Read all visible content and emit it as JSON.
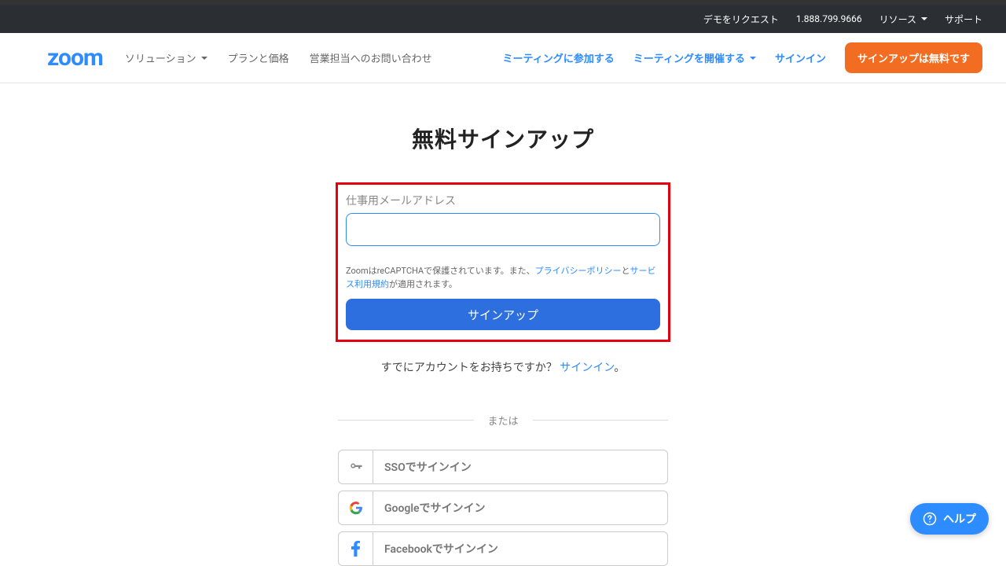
{
  "topbar": {
    "demo": "デモをリクエスト",
    "phone": "1.888.799.9666",
    "resources": "リソース",
    "support": "サポート"
  },
  "logo": "zoom",
  "nav": {
    "solutions": "ソリューション",
    "plans": "プランと価格",
    "contact_sales": "営業担当へのお問い合わせ",
    "join_meeting": "ミーティングに参加する",
    "host_meeting": "ミーティングを開催する",
    "sign_in": "サインイン",
    "signup_free": "サインアップは無料です"
  },
  "page": {
    "title": "無料サインアップ",
    "email_label": "仕事用メールアドレス",
    "legal_prefix": "ZoomはreCAPTCHAで保護されています。また、",
    "privacy": "プライバシーポリシー",
    "legal_and": "と",
    "terms": "サービス利用規約",
    "legal_suffix": "が適用されます。",
    "signup_button": "サインアップ",
    "already_prefix": "すでにアカウントをお持ちですか？",
    "signin_link": "サインイン",
    "already_suffix": "。",
    "divider": "または"
  },
  "social": {
    "sso": "SSOでサインイン",
    "google": "Googleでサインイン",
    "facebook": "Facebookでサインイン"
  },
  "help": "ヘルプ"
}
